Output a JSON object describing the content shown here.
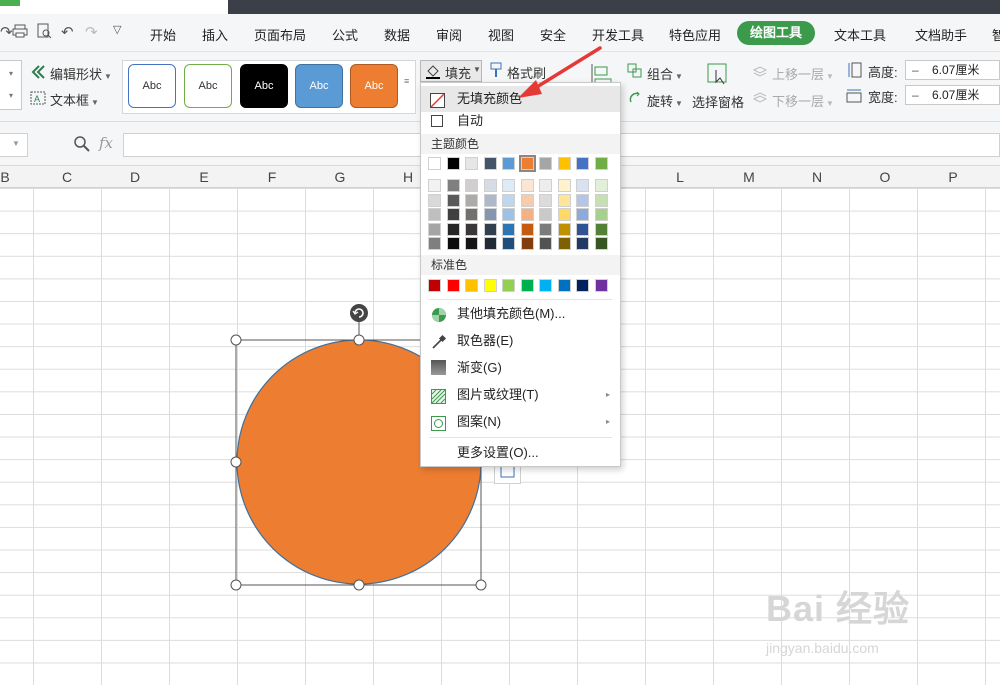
{
  "menubar": {
    "items": [
      "开始",
      "插入",
      "页面布局",
      "公式",
      "数据",
      "审阅",
      "视图",
      "安全",
      "开发工具",
      "特色应用"
    ],
    "active_tab": "绘图工具",
    "items_right": [
      "文本工具",
      "文档助手",
      "智"
    ]
  },
  "ribbon": {
    "edit_shape": "编辑形状",
    "textbox": "文本框",
    "style_samples": [
      {
        "label": "Abc",
        "bg": "#ffffff",
        "border": "#4472c4",
        "color": "#333333"
      },
      {
        "label": "Abc",
        "bg": "#ffffff",
        "border": "#70ad47",
        "color": "#333333"
      },
      {
        "label": "Abc",
        "bg": "#000000",
        "border": "#000000",
        "color": "#ffffff"
      },
      {
        "label": "Abc",
        "bg": "#5b9bd5",
        "border": "#41719c",
        "color": "#ffffff"
      },
      {
        "label": "Abc",
        "bg": "#ed7d31",
        "border": "#ae5a21",
        "color": "#ffffff"
      }
    ],
    "fill": "填充",
    "format_painter": "格式刷",
    "group": "组合",
    "rotate": "旋转",
    "selection_pane": "选择窗格",
    "bring_forward": "上移一层",
    "send_backward": "下移一层",
    "height_label": "高度:",
    "height_value": "6.07厘米",
    "width_label": "宽度:",
    "width_value": "6.07厘米"
  },
  "formula": {
    "fx": "fx"
  },
  "columns": [
    "B",
    "C",
    "D",
    "E",
    "F",
    "G",
    "H",
    "L",
    "M",
    "N",
    "O",
    "P"
  ],
  "fill_menu": {
    "no_fill": "无填充颜色",
    "automatic": "自动",
    "theme_colors": "主题颜色",
    "standard_colors": "标准色",
    "more_colors": "其他填充颜色(M)...",
    "eyedropper": "取色器(E)",
    "gradient": "渐变(G)",
    "picture_texture": "图片或纹理(T)",
    "pattern": "图案(N)",
    "more_settings": "更多设置(O)...",
    "theme_top": [
      "#ffffff",
      "#000000",
      "#e7e6e6",
      "#44546a",
      "#5b9bd5",
      "#ed7d31",
      "#a5a5a5",
      "#ffc000",
      "#4472c4",
      "#70ad47"
    ],
    "theme_shades": [
      [
        "#f2f2f2",
        "#7f7f7f",
        "#d0cece",
        "#d6dce4",
        "#deeaf6",
        "#fbe5d5",
        "#ededed",
        "#fff2cc",
        "#d9e2f3",
        "#e2efd9"
      ],
      [
        "#d9d9d9",
        "#595959",
        "#aeaaaa",
        "#adb9ca",
        "#bdd7ee",
        "#f7cbac",
        "#dbdbdb",
        "#fee599",
        "#b4c6e7",
        "#c5e0b3"
      ],
      [
        "#bfbfbf",
        "#3f3f3f",
        "#757070",
        "#8496b0",
        "#9cc3e5",
        "#f4b183",
        "#c9c9c9",
        "#ffd965",
        "#8eaadb",
        "#a8d08d"
      ],
      [
        "#a5a5a5",
        "#262626",
        "#3a3838",
        "#323f4f",
        "#2e75b5",
        "#c55a11",
        "#7b7b7b",
        "#bf9000",
        "#2f5496",
        "#538135"
      ],
      [
        "#7f7f7f",
        "#0c0c0c",
        "#171616",
        "#222a35",
        "#1e4e79",
        "#833c0b",
        "#525252",
        "#7f6000",
        "#1f3864",
        "#375623"
      ]
    ],
    "standard": [
      "#c00000",
      "#ff0000",
      "#ffc000",
      "#ffff00",
      "#92d050",
      "#00b050",
      "#00b0f0",
      "#0070c0",
      "#002060",
      "#7030a0"
    ]
  },
  "shape": {
    "fill_color": "#ed7d31"
  },
  "colors": {
    "accent_green": "#3c9a4d",
    "arrow_red": "#e53935"
  },
  "watermark": {
    "main": "Bai 经验",
    "sub": "jingyan.baidu.com"
  }
}
